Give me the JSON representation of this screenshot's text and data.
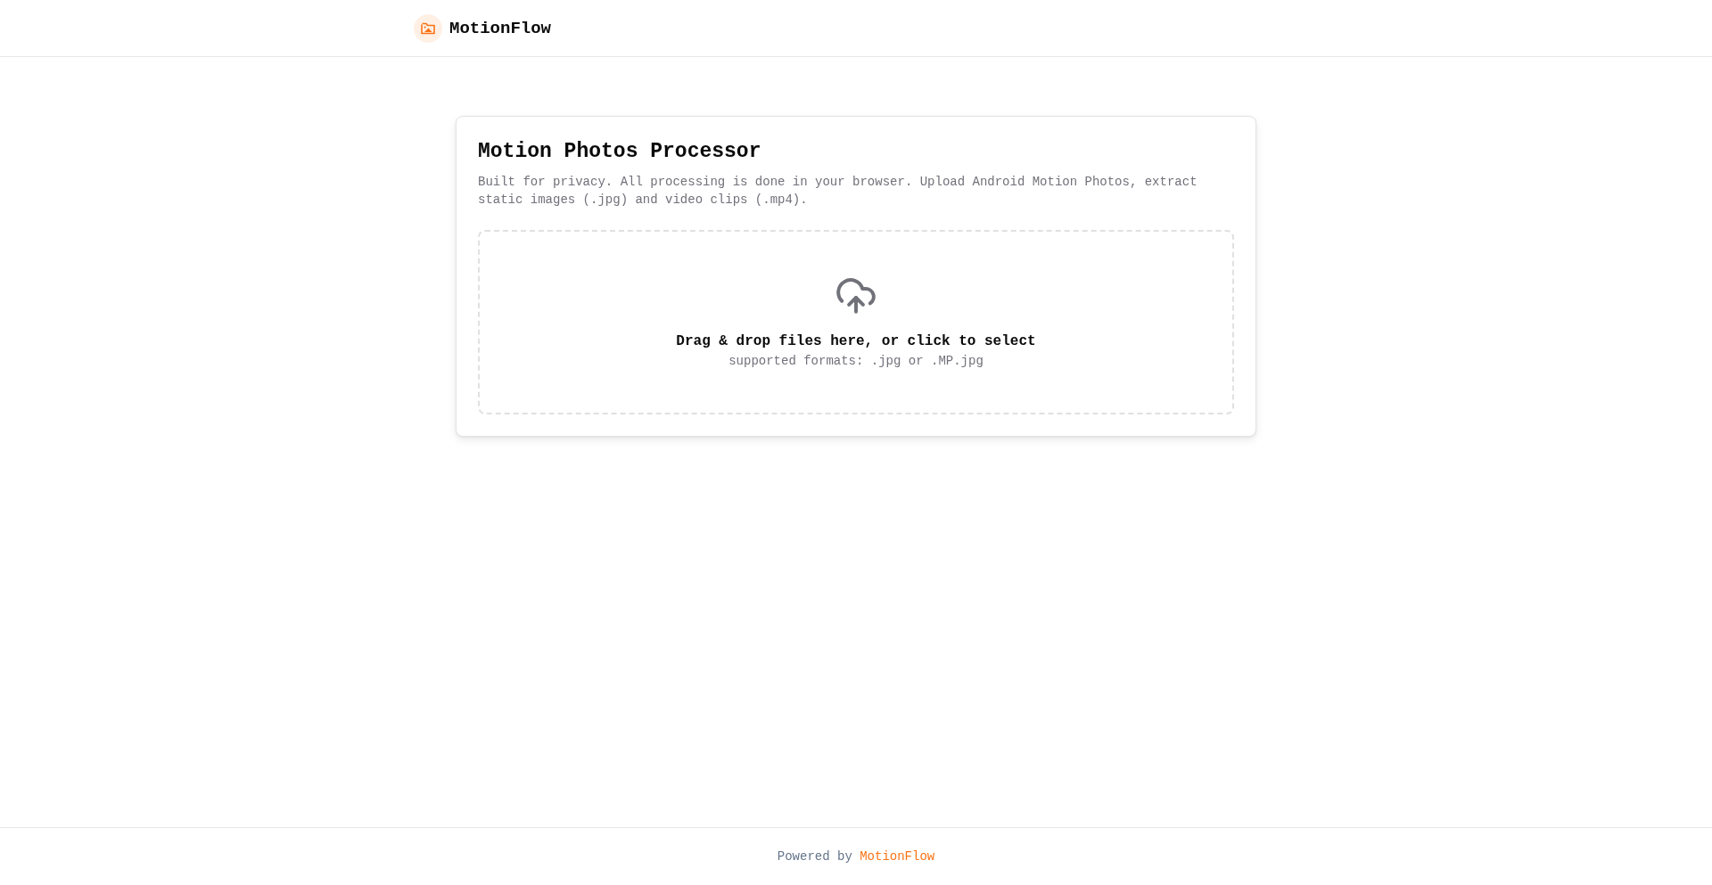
{
  "header": {
    "brand": "MotionFlow"
  },
  "card": {
    "title": "Motion Photos Processor",
    "description": "Built for privacy. All processing is done in your browser. Upload Android Motion Photos, extract static images (.jpg) and video clips (.mp4).",
    "dropzone": {
      "prompt": "Drag & drop files here, or click to select",
      "hint": "supported formats: .jpg or .MP.jpg"
    }
  },
  "footer": {
    "prefix": "Powered by",
    "link": "MotionFlow"
  }
}
